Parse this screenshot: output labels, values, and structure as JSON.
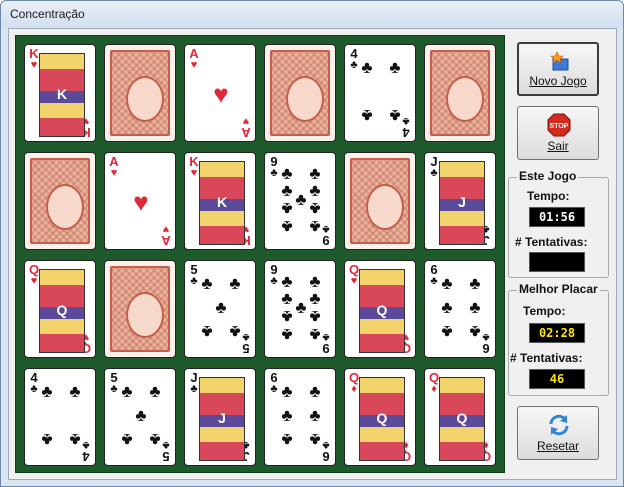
{
  "window": {
    "title": "Concentração"
  },
  "buttons": {
    "new_game": "Novo Jogo",
    "exit": "Sair",
    "reset": "Resetar"
  },
  "current_game": {
    "legend": "Este Jogo",
    "time_label": "Tempo:",
    "time_value": "01:56",
    "attempts_label": "# Tentativas:",
    "attempts_value": ""
  },
  "best_score": {
    "legend": "Melhor Placar",
    "time_label": "Tempo:",
    "time_value": "02:28",
    "attempts_label": "# Tentativas:",
    "attempts_value": "46"
  },
  "icons": {
    "new_game": "new-game-icon",
    "exit": "stop-sign-icon",
    "reset": "refresh-icon"
  },
  "colors": {
    "red_suit": "#e0283a",
    "board": "#1e5a2c",
    "card_back": "#c45e4a",
    "lcd_yellow": "#ffe400"
  },
  "cards": [
    {
      "rank": "K",
      "suit": "♥",
      "face_up": true
    },
    {
      "face_up": false
    },
    {
      "rank": "A",
      "suit": "♥",
      "face_up": true
    },
    {
      "face_up": false
    },
    {
      "rank": "4",
      "suit": "♣",
      "face_up": true
    },
    {
      "face_up": false
    },
    {
      "face_up": false
    },
    {
      "rank": "A",
      "suit": "♥",
      "face_up": true
    },
    {
      "rank": "K",
      "suit": "♥",
      "face_up": true
    },
    {
      "rank": "9",
      "suit": "♣",
      "face_up": true
    },
    {
      "face_up": false
    },
    {
      "rank": "J",
      "suit": "♣",
      "face_up": true
    },
    {
      "rank": "Q",
      "suit": "♥",
      "face_up": true
    },
    {
      "face_up": false
    },
    {
      "rank": "5",
      "suit": "♣",
      "face_up": true
    },
    {
      "rank": "9",
      "suit": "♣",
      "face_up": true
    },
    {
      "rank": "Q",
      "suit": "♥",
      "face_up": true
    },
    {
      "rank": "6",
      "suit": "♣",
      "face_up": true
    },
    {
      "rank": "4",
      "suit": "♣",
      "face_up": true
    },
    {
      "rank": "5",
      "suit": "♣",
      "face_up": true
    },
    {
      "rank": "J",
      "suit": "♣",
      "face_up": true
    },
    {
      "rank": "6",
      "suit": "♣",
      "face_up": true
    },
    {
      "rank": "Q",
      "suit": "♦",
      "face_up": true
    },
    {
      "rank": "Q",
      "suit": "♦",
      "face_up": true
    }
  ]
}
